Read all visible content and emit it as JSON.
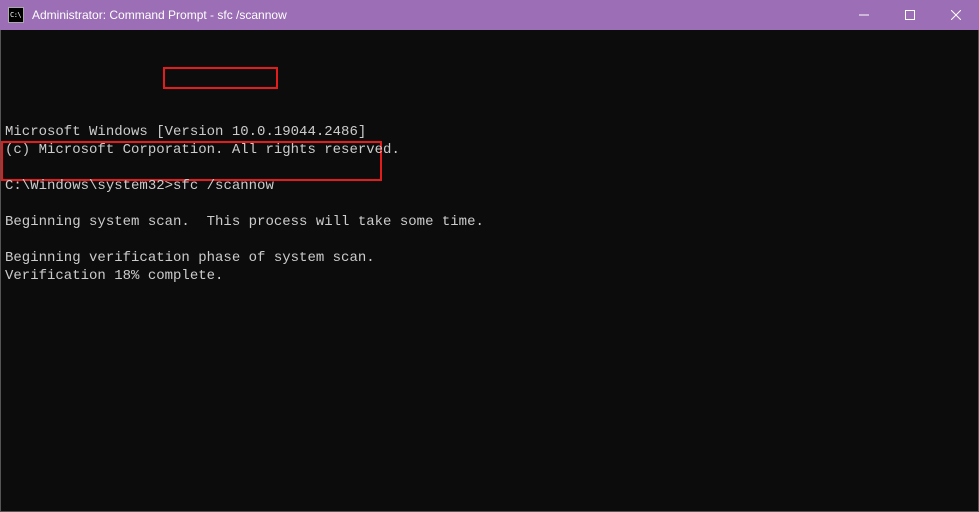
{
  "titlebar": {
    "icon_text": "C:\\",
    "title": "Administrator: Command Prompt - sfc  /scannow"
  },
  "terminal": {
    "line1": "Microsoft Windows [Version 10.0.19044.2486]",
    "line2": "(c) Microsoft Corporation. All rights reserved.",
    "blank1": "",
    "prompt": "C:\\Windows\\system32>",
    "command": "sfc /scannow",
    "blank2": "",
    "line3": "Beginning system scan.  This process will take some time.",
    "blank3": "",
    "line4": "Beginning verification phase of system scan.",
    "line5": "Verification 18% complete."
  }
}
